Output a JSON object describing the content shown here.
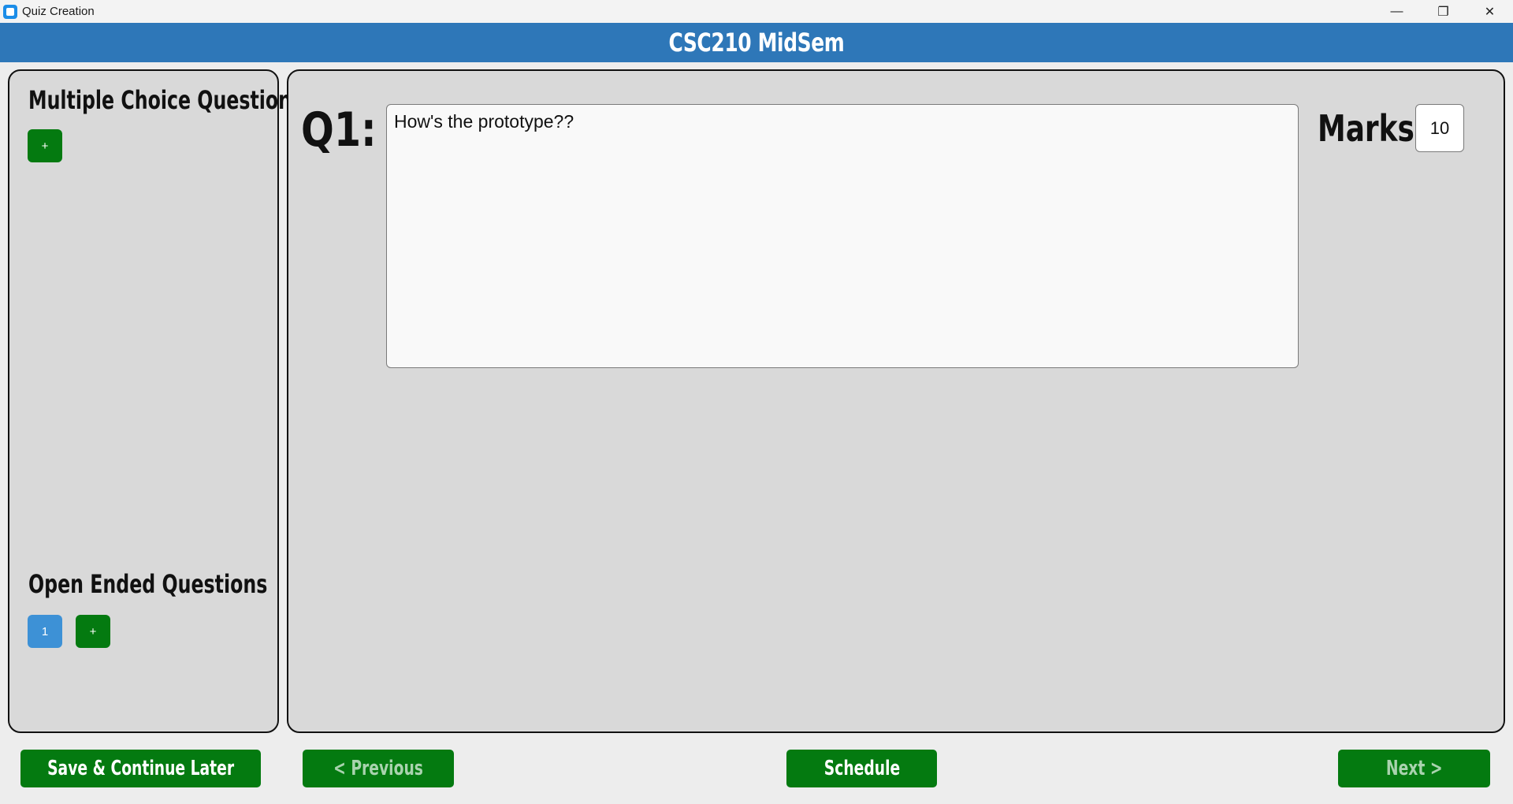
{
  "window": {
    "title": "Quiz Creation",
    "controls": {
      "minimize": "—",
      "restore": "❐",
      "close": "✕"
    }
  },
  "header": {
    "title": "CSC210 MidSem"
  },
  "sidebar": {
    "mcq": {
      "title": "Multiple Choice Questions",
      "add_label": "+"
    },
    "open": {
      "title": "Open Ended Questions",
      "items": [
        "1"
      ],
      "add_label": "+"
    }
  },
  "question": {
    "label": "Q1:",
    "text": "How's the prototype??",
    "marks_label": "Marks:",
    "marks_value": "10"
  },
  "footer": {
    "save_label": "Save & Continue Later",
    "previous_label": "< Previous",
    "schedule_label": "Schedule",
    "next_label": "Next >"
  },
  "colors": {
    "header": "#2e77b8",
    "button_green": "#047a10",
    "question_selected": "#3d91d6",
    "panel": "#d9d9d9"
  }
}
